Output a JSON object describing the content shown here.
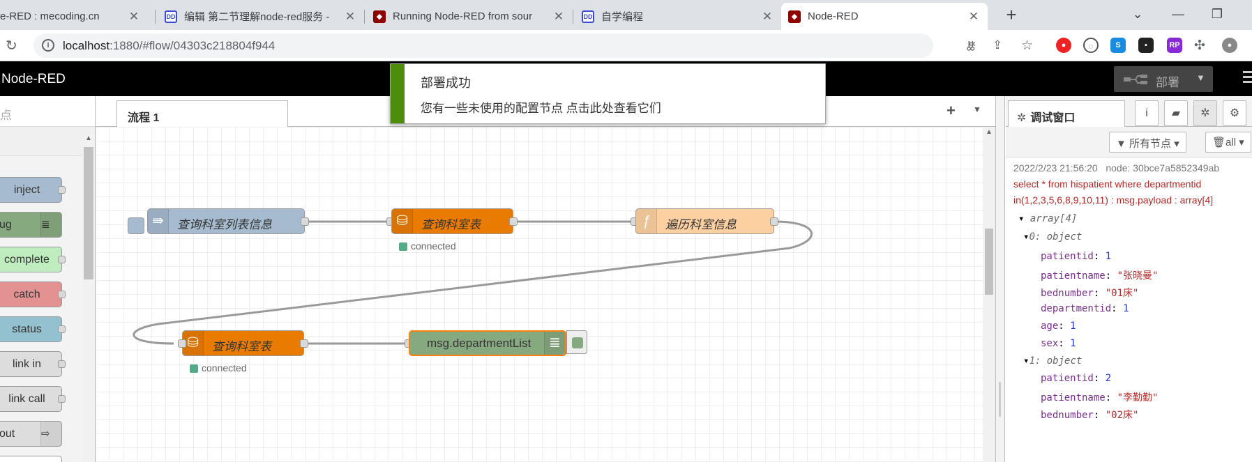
{
  "browser": {
    "tabs": [
      {
        "title": "e-RED : mecoding.cn",
        "favicon": "none"
      },
      {
        "title": "编辑 第二节理解node-red服务 -",
        "favicon": "csdn-icon"
      },
      {
        "title": "Running Node-RED from sour",
        "favicon": "node-red-icon"
      },
      {
        "title": "自学编程",
        "favicon": "csdn-icon"
      },
      {
        "title": "Node-RED",
        "favicon": "node-red-icon"
      }
    ],
    "url_host": "localhost",
    "url_rest": ":1880/#flow/04303c218804f944"
  },
  "header": {
    "logo": "Node-RED",
    "deploy_label": "部署"
  },
  "palette": {
    "search_placeholder": "点",
    "nodes": [
      {
        "label": "inject",
        "color": "#a6bbcf"
      },
      {
        "label": "ug",
        "color": "#87a980"
      },
      {
        "label": "complete",
        "color": "#c0edc0"
      },
      {
        "label": "catch",
        "color": "#e49191"
      },
      {
        "label": "status",
        "color": "#94c1d0"
      },
      {
        "label": "link in",
        "color": "#dddddd"
      },
      {
        "label": "link call",
        "color": "#dddddd"
      },
      {
        "label": "out",
        "color": "#dddddd"
      }
    ]
  },
  "workspace": {
    "tab": "流程 1",
    "nodes": {
      "inject": "查询科室列表信息",
      "db1": "查询科室表",
      "func": "遍历科室信息",
      "db2": "查询科室表",
      "debug": "msg.departmentList"
    },
    "status_db1": "connected",
    "status_db2": "connected"
  },
  "notification": {
    "title": "部署成功",
    "message": "您有一些未使用的配置节点 点击此处查看它们"
  },
  "sidebar": {
    "tab_label": "调试窗口",
    "filter_label": "所有节点",
    "clear_label": "all",
    "message": {
      "timestamp": "2022/2/23 21:56:20",
      "node": "node: 30bce7a5852349ab",
      "topic_line1": "select * from hispatient where departmentid",
      "topic_line2": "in(1,2,3,5,6,8,9,10,11) : msg.payload : array[4]",
      "root": "array[4]",
      "item0": "0: object",
      "item1": "1: object",
      "k_patientid": "patientid",
      "k_patientname": "patientname",
      "k_bednumber": "bednumber",
      "k_departmentid": "departmentid",
      "k_age": "age",
      "k_sex": "sex",
      "v0_patientid": "1",
      "v0_patientname": "\"张晓曼\"",
      "v0_bednumber": "\"01床\"",
      "v0_departmentid": "1",
      "v0_age": "1",
      "v0_sex": "1",
      "v1_patientid": "2",
      "v1_patientname": "\"李勤勤\"",
      "v1_bednumber": "\"02床\""
    }
  }
}
